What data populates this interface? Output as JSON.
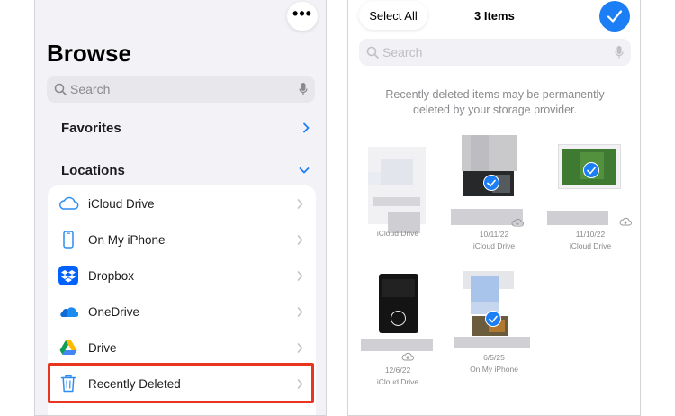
{
  "browse": {
    "title": "Browse",
    "search_placeholder": "Search",
    "favorites_label": "Favorites",
    "locations_label": "Locations",
    "locations": [
      {
        "label": "iCloud Drive",
        "icon": "icloud-icon"
      },
      {
        "label": "On My iPhone",
        "icon": "iphone-icon"
      },
      {
        "label": "Dropbox",
        "icon": "dropbox-icon"
      },
      {
        "label": "OneDrive",
        "icon": "onedrive-icon"
      },
      {
        "label": "Drive",
        "icon": "google-drive-icon"
      },
      {
        "label": "Recently Deleted",
        "icon": "trash-icon"
      }
    ]
  },
  "deleted": {
    "select_all_label": "Select All",
    "title": "3 Items",
    "search_placeholder": "Search",
    "notice_line1": "Recently deleted items may be permanently",
    "notice_line2": "deleted by your storage provider.",
    "files": [
      {
        "date": "",
        "location": "iCloud Drive",
        "selected": false
      },
      {
        "date": "10/11/22",
        "location": "iCloud Drive",
        "selected": true
      },
      {
        "date": "11/10/22",
        "location": "iCloud Drive",
        "selected": true
      },
      {
        "date": "12/6/22",
        "location": "iCloud Drive",
        "selected": false
      },
      {
        "date": "6/5/25",
        "location": "On My iPhone",
        "selected": true
      }
    ]
  },
  "colors": {
    "accent": "#1c7ef5",
    "highlight": "#e8351f"
  }
}
